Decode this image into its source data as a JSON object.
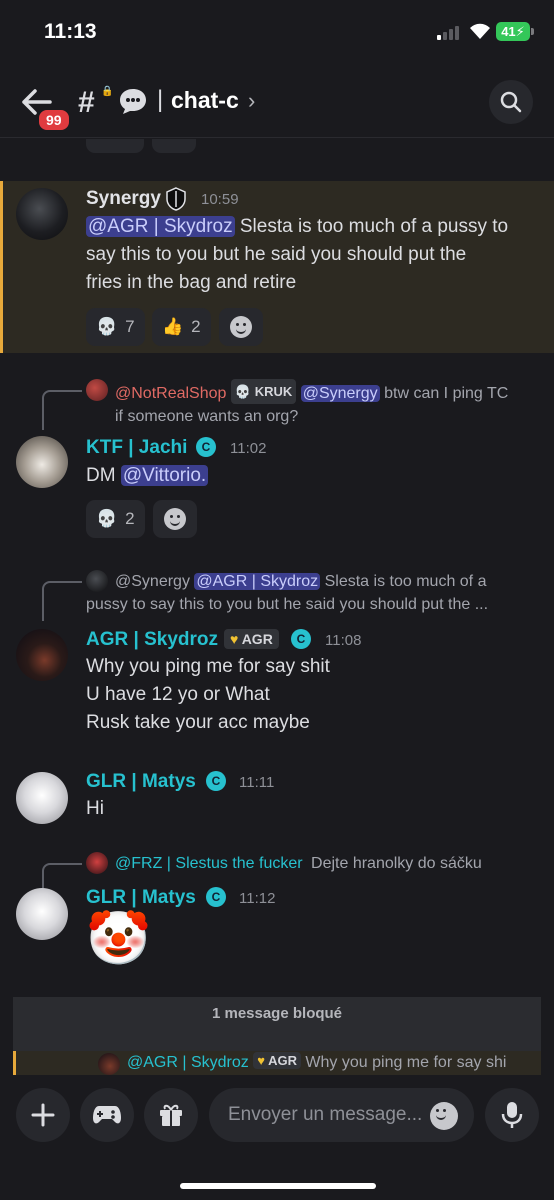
{
  "status_bar": {
    "time": "11:13",
    "battery": "41"
  },
  "header": {
    "badge_count": "99",
    "separator": "|",
    "channel_name": "chat-c"
  },
  "messages": [
    {
      "author": "Synergy",
      "time": "10:59",
      "mention": "@AGR | Skydroz",
      "lines": [
        "Slesta is too much of a pussy to",
        "say this to you but he said you should put the",
        "fries in the bag and retire"
      ],
      "reactions": [
        {
          "emoji": "💀",
          "count": "7"
        },
        {
          "emoji": "👍",
          "count": "2"
        }
      ]
    },
    {
      "reply": {
        "author": "@NotRealShop",
        "tag": "KRUK",
        "mention": "@Synergy",
        "text_1": "btw can I ping TC",
        "text_2": "if someone wants an org?"
      },
      "author": "KTF | Jachi",
      "time": "11:02",
      "text": "DM",
      "mention": "@Vittorio.",
      "reactions": [
        {
          "emoji": "💀",
          "count": "2"
        }
      ]
    },
    {
      "reply": {
        "author": "@Synergy",
        "mention": "@AGR | Skydroz",
        "text_1": "Slesta is too much of a",
        "text_2": "pussy to say this to you but he said you should put the ..."
      },
      "author": "AGR | Skydroz",
      "tag": "AGR",
      "time": "11:08",
      "lines": [
        "Why you ping me for say shit",
        "U have 12 yo or What",
        "Rusk take your acc maybe"
      ]
    },
    {
      "author": "GLR | Matys",
      "time": "11:11",
      "text": "Hi"
    },
    {
      "reply": {
        "author": "@FRZ | Slestus the fucker",
        "text_1": "Dejte hranolky do sáčku"
      },
      "author": "GLR | Matys",
      "time": "11:12",
      "emoji": "🤡"
    }
  ],
  "blocked": {
    "label": "1 message bloqué",
    "reply_author": "@AGR | Skydroz",
    "reply_tag": "AGR",
    "reply_text": "Why you ping me for say shi"
  },
  "composer": {
    "placeholder": "Envoyer un message..."
  },
  "colors": {
    "accent_cyan": "#27c1cf",
    "mention_bg": "#3c3f8f",
    "highlight_bar": "#e7a93b",
    "badge_red": "#e03b3f"
  }
}
